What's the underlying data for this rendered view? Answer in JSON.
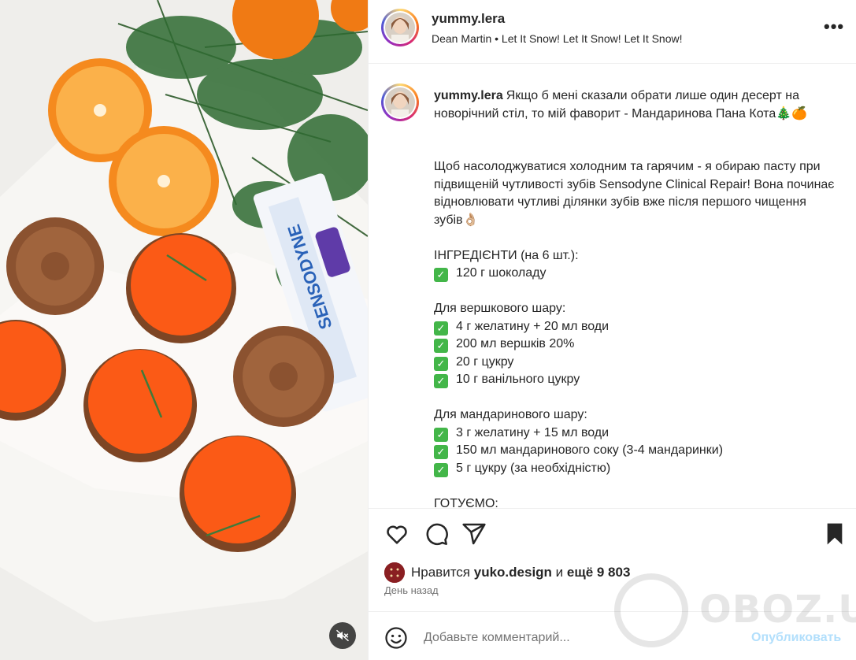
{
  "post": {
    "username": "yummy.lera",
    "music": "Dean Martin • Let It Snow! Let It Snow! Let It Snow!",
    "more_label": "•••"
  },
  "caption": {
    "username": "yummy.lera",
    "lines": [
      "Якщо б мені сказали обрати лише один десерт на новорічний стіл, то мій фаворит - Мандаринова Пана Кота🎄🍊",
      "",
      "",
      "Щоб насолоджуватися холодним та гарячим - я обираю пасту при підвищеній чутливості зубів Sensodyne Clinical Repair! Вона починає відновлювати чутливі ділянки зубів вже після першого чищення зубів👌🏼",
      "",
      "ІНГРЕДІЄНТИ (на 6 шт.):",
      "120 г шоколаду",
      "",
      "Для вершкового шару:",
      "4 г желатину + 20 мл води",
      "200 мл вершків 20%",
      "20 г цукру",
      "10 г ванільного цукру",
      "",
      "Для мандаринового шару:",
      "3 г желатину + 15 мл води",
      "150 мл мандаринового соку (3-4 мандаринки)",
      "5 г цукру (за необхідністю)",
      "",
      "ГОТУЄМО:"
    ],
    "checked_lines": [
      6,
      9,
      10,
      11,
      12,
      15,
      16,
      17
    ]
  },
  "actions": {
    "like_icon": "heart-icon",
    "comment_icon": "comment-icon",
    "share_icon": "share-icon",
    "save_icon": "bookmark-icon"
  },
  "likes": {
    "prefix": "Нравится",
    "user": "yuko.design",
    "middle": "и",
    "rest": "ещё 9 803"
  },
  "time_ago": "День назад",
  "comment": {
    "placeholder": "Добавьте комментарий...",
    "publish_label": "Опубликовать",
    "emoji_icon": "smiley-icon"
  },
  "media": {
    "mute_icon": "speaker-muted-icon",
    "product_label": "SENSODYNE"
  },
  "watermark": {
    "text": "OBOZ.UA"
  },
  "colors": {
    "accent": "#0095f6",
    "publish_disabled": "#b2dffc",
    "text": "#262626",
    "muted": "#737373",
    "checkmark": "#43b649"
  }
}
